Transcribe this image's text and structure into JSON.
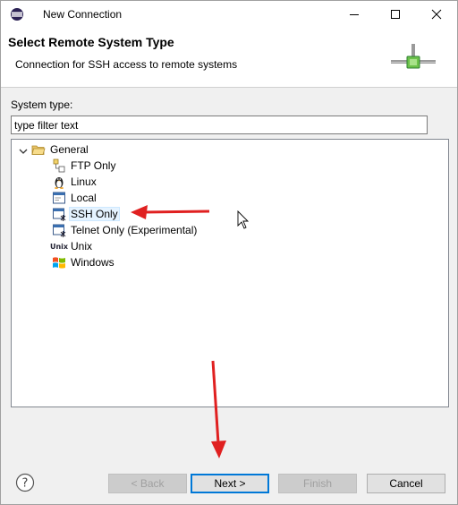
{
  "window": {
    "title": "New Connection"
  },
  "banner": {
    "title": "Select Remote System Type",
    "subtitle": "Connection for SSH access to remote systems",
    "icon": "network-connection-icon"
  },
  "filter": {
    "label": "System type:",
    "value": "type filter text"
  },
  "tree": {
    "root": {
      "label": "General",
      "expanded": true,
      "icon": "folder-open-icon"
    },
    "items": [
      {
        "label": "FTP Only",
        "icon": "ftp-icon"
      },
      {
        "label": "Linux",
        "icon": "linux-penguin-icon"
      },
      {
        "label": "Local",
        "icon": "local-computer-icon"
      },
      {
        "label": "SSH Only",
        "icon": "ssh-terminal-icon",
        "selected": true
      },
      {
        "label": "Telnet Only (Experimental)",
        "icon": "telnet-terminal-icon"
      },
      {
        "label": "Unix",
        "icon": "unix-icon",
        "icon_text": "Unix"
      },
      {
        "label": "Windows",
        "icon": "windows-flag-icon"
      }
    ]
  },
  "buttons": {
    "back": "< Back",
    "next": "Next >",
    "finish": "Finish",
    "cancel": "Cancel"
  },
  "colors": {
    "accent": "#0078d7",
    "annotation_arrow": "#e02020",
    "selection": "#e5f3ff"
  }
}
